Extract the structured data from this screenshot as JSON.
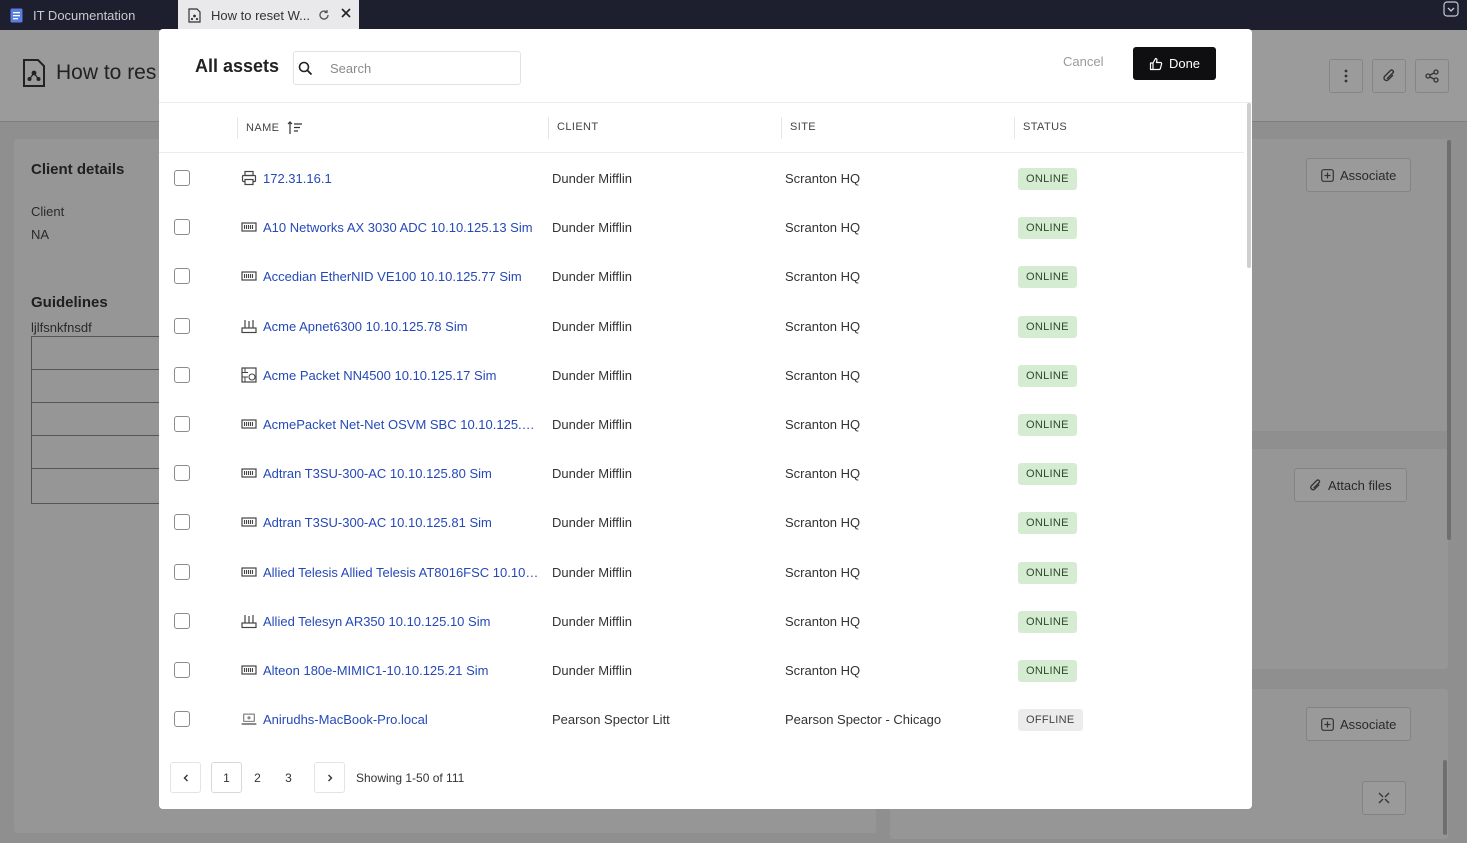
{
  "browser": {
    "tabs": [
      {
        "title": "IT Documentation"
      },
      {
        "title": "How to reset W..."
      }
    ]
  },
  "background": {
    "page_title": "How to res",
    "client_details": {
      "heading": "Client details",
      "label": "Client",
      "value": "NA"
    },
    "guidelines": {
      "heading": "Guidelines",
      "text": "ljlfsnkfnsdf"
    },
    "associate_label_1": "Associate",
    "attach_files_label": "Attach files",
    "associate_label_2": "Associate"
  },
  "modal": {
    "title": "All assets",
    "search": {
      "placeholder": "Search",
      "value": ""
    },
    "cancel_label": "Cancel",
    "done_label": "Done",
    "columns": {
      "name": "NAME",
      "client": "CLIENT",
      "site": "SITE",
      "status": "STATUS"
    },
    "assets": [
      {
        "icon": "printer-icon",
        "name": "172.31.16.1",
        "client": "Dunder Mifflin",
        "site": "Scranton HQ",
        "status": "ONLINE"
      },
      {
        "icon": "network-device-icon",
        "name": "A10 Networks AX 3030 ADC 10.10.125.13 Sim",
        "client": "Dunder Mifflin",
        "site": "Scranton HQ",
        "status": "ONLINE"
      },
      {
        "icon": "network-device-icon",
        "name": "Accedian EtherNID VE100 10.10.125.77 Sim",
        "client": "Dunder Mifflin",
        "site": "Scranton HQ",
        "status": "ONLINE"
      },
      {
        "icon": "router-icon",
        "name": "Acme Apnet6300 10.10.125.78 Sim",
        "client": "Dunder Mifflin",
        "site": "Scranton HQ",
        "status": "ONLINE"
      },
      {
        "icon": "firewall-icon",
        "name": "Acme Packet NN4500 10.10.125.17 Sim",
        "client": "Dunder Mifflin",
        "site": "Scranton HQ",
        "status": "ONLINE"
      },
      {
        "icon": "network-device-icon",
        "name": "AcmePacket Net-Net OSVM SBC 10.10.125.7...",
        "client": "Dunder Mifflin",
        "site": "Scranton HQ",
        "status": "ONLINE"
      },
      {
        "icon": "network-device-icon",
        "name": "Adtran T3SU-300-AC 10.10.125.80 Sim",
        "client": "Dunder Mifflin",
        "site": "Scranton HQ",
        "status": "ONLINE"
      },
      {
        "icon": "network-device-icon",
        "name": "Adtran T3SU-300-AC 10.10.125.81 Sim",
        "client": "Dunder Mifflin",
        "site": "Scranton HQ",
        "status": "ONLINE"
      },
      {
        "icon": "network-device-icon",
        "name": "Allied Telesis Allied Telesis AT8016FSC 10.10....",
        "client": "Dunder Mifflin",
        "site": "Scranton HQ",
        "status": "ONLINE"
      },
      {
        "icon": "router-icon",
        "name": "Allied Telesyn AR350 10.10.125.10 Sim",
        "client": "Dunder Mifflin",
        "site": "Scranton HQ",
        "status": "ONLINE"
      },
      {
        "icon": "network-device-icon",
        "name": "Alteon 180e-MIMIC1-10.10.125.21 Sim",
        "client": "Dunder Mifflin",
        "site": "Scranton HQ",
        "status": "ONLINE"
      },
      {
        "icon": "laptop-icon",
        "name": "Anirudhs-MacBook-Pro.local",
        "client": "Pearson Spector Litt",
        "site": "Pearson Spector - Chicago",
        "status": "OFFLINE"
      }
    ],
    "pagination": {
      "pages": [
        "1",
        "2",
        "3"
      ],
      "current": "1",
      "showing": "Showing 1-50 of 111"
    }
  },
  "colors": {
    "link": "#2549b8",
    "online_bg": "#d6ecd2",
    "offline_bg": "#ececec",
    "done_bg": "#0f0f12"
  }
}
